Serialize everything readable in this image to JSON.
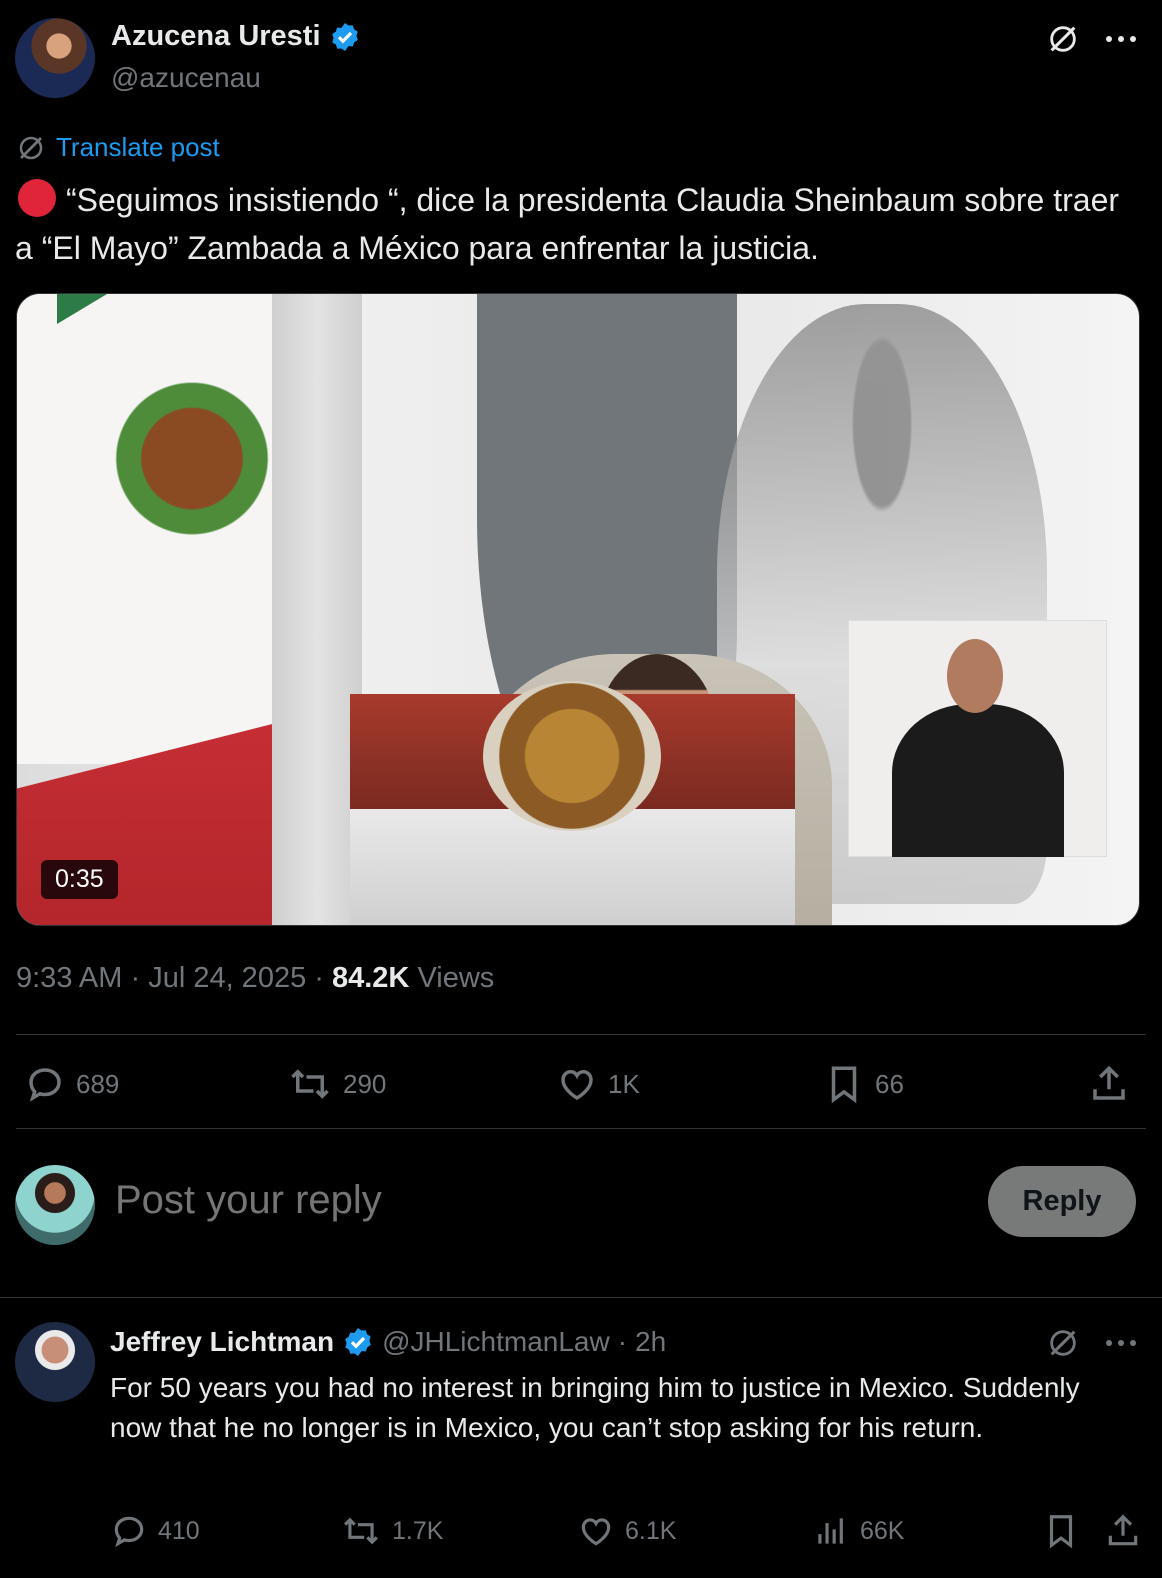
{
  "post": {
    "author_name": "Azucena Uresti",
    "author_handle": "@azucenau",
    "translate_label": "Translate post",
    "text": "“Seguimos insistiendo “, dice la presidenta Claudia Sheinbaum sobre traer a “El Mayo” Zambada a México para enfrentar la justicia.",
    "video_duration": "0:35",
    "time": "9:33 AM",
    "date": "Jul 24, 2025",
    "views_count": "84.2K",
    "views_label": "Views",
    "stats": {
      "replies": "689",
      "reposts": "290",
      "likes": "1K",
      "bookmarks": "66"
    }
  },
  "reply_box": {
    "placeholder": "Post your reply",
    "button_label": "Reply"
  },
  "reply": {
    "author_name": "Jeffrey Lichtman",
    "author_handle": "@JHLichtmanLaw",
    "time_ago": "2h",
    "text": "For 50 years you had no interest in bringing him to justice in Mexico. Suddenly now that he no longer is in Mexico, you can’t stop asking for his return.",
    "stats": {
      "replies": "410",
      "reposts": "1.7K",
      "likes": "6.1K",
      "views": "66K"
    }
  },
  "colors": {
    "background": "#000000",
    "text": "#e7e9ea",
    "muted": "#71767b",
    "accent": "#1d9bf0",
    "red_dot": "#e0253a",
    "reply_button": "#787a7a"
  },
  "icons": [
    "grok-icon",
    "more-icon",
    "verified-badge-icon",
    "reply-icon",
    "repost-icon",
    "like-icon",
    "bookmark-icon",
    "share-icon",
    "views-icon"
  ]
}
